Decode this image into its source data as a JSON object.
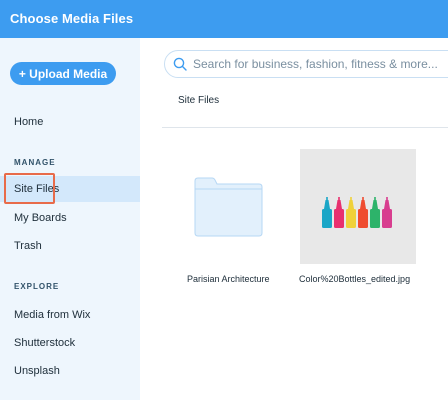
{
  "window": {
    "title": "Choose Media Files"
  },
  "sidebar": {
    "upload_label": "+ Upload Media",
    "home": "Home",
    "manage_label": "MANAGE",
    "manage_items": [
      "Site Files",
      "My Boards",
      "Trash"
    ],
    "explore_label": "EXPLORE",
    "explore_items": [
      "Media from Wix",
      "Shutterstock",
      "Unsplash"
    ]
  },
  "main": {
    "search_placeholder": "Search for business, fashion, fitness & more...",
    "breadcrumb": "Site Files",
    "files": [
      {
        "name": "Parisian Architecture",
        "kind": "folder"
      },
      {
        "name": "Color%20Bottles_edited.jpg",
        "kind": "image"
      }
    ]
  },
  "colors": {
    "accent": "#3d9cf0",
    "sidebar_bg": "#eef6fd",
    "active_bg": "#d3e8fb",
    "highlight": "#e86b4a"
  }
}
